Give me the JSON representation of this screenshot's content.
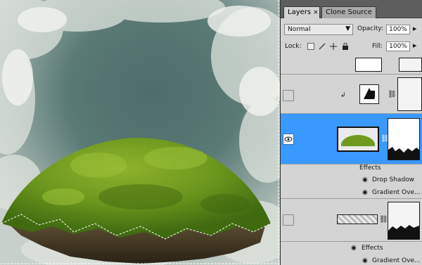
{
  "panel": {
    "tabs": [
      {
        "label": "Layers",
        "close": "×"
      },
      {
        "label": "Clone Source"
      }
    ],
    "blend_mode": "Normal",
    "opacity_label": "Opacity:",
    "opacity_value": "100%",
    "lock_label": "Lock:",
    "fill_label": "Fill:",
    "fill_value": "100%"
  },
  "layers": {
    "effects_label_1": "Effects",
    "effect_drop_shadow": "Drop Shadow",
    "effect_gradient_1": "Gradient Ove...",
    "effects_label_2": "Effects",
    "effect_gradient_2": "Gradient Ove..."
  },
  "colors": {
    "selection": "#3a99ff",
    "panel_bg": "#d4d4d4",
    "moss": "#6f9a1e"
  },
  "icons": [
    "close-icon",
    "dropdown-arrow-icon",
    "lock-transparent-icon",
    "lock-brush-icon",
    "lock-move-icon",
    "lock-all-icon",
    "eye-icon",
    "link-chain-icon",
    "fx-icon"
  ]
}
